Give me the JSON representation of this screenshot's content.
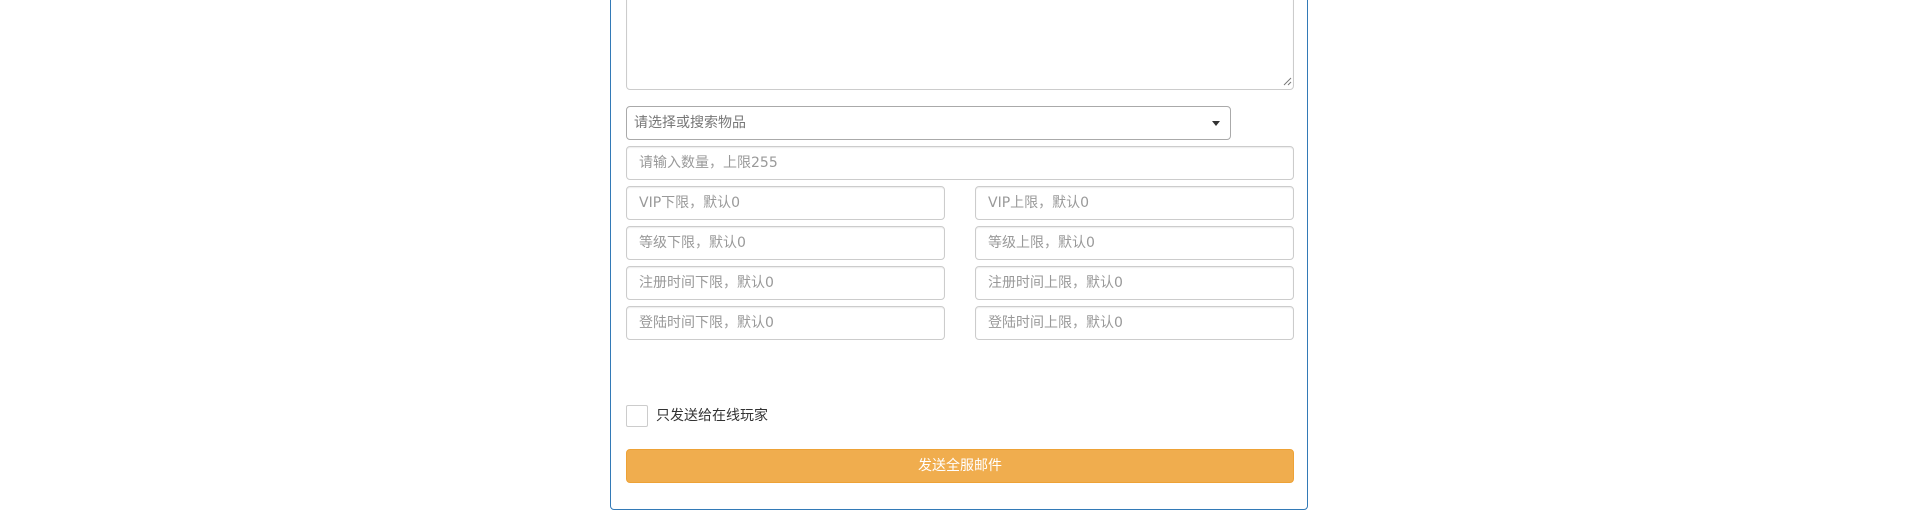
{
  "form": {
    "message_value": "",
    "item_select": {
      "placeholder": "请选择或搜索物品"
    },
    "quantity": {
      "value": "",
      "placeholder": "请输入数量，上限255"
    },
    "vip_min": {
      "value": "",
      "placeholder": "VIP下限，默认0"
    },
    "vip_max": {
      "value": "",
      "placeholder": "VIP上限，默认0"
    },
    "level_min": {
      "value": "",
      "placeholder": "等级下限，默认0"
    },
    "level_max": {
      "value": "",
      "placeholder": "等级上限，默认0"
    },
    "register_time_min": {
      "value": "",
      "placeholder": "注册时间下限，默认0"
    },
    "register_time_max": {
      "value": "",
      "placeholder": "注册时间上限，默认0"
    },
    "login_time_min": {
      "value": "",
      "placeholder": "登陆时间下限，默认0"
    },
    "login_time_max": {
      "value": "",
      "placeholder": "登陆时间上限，默认0"
    },
    "online_only": {
      "checked": false,
      "label": "只发送给在线玩家"
    },
    "send_button_label": "发送全服邮件"
  },
  "icons": {
    "select_caret": "caret-down-icon",
    "textarea_resize": "resize-grip-icon"
  },
  "colors": {
    "panel_border": "#337ab7",
    "button_bg": "#f0ad4e",
    "button_border": "#eea236",
    "button_text": "#ffffff"
  }
}
